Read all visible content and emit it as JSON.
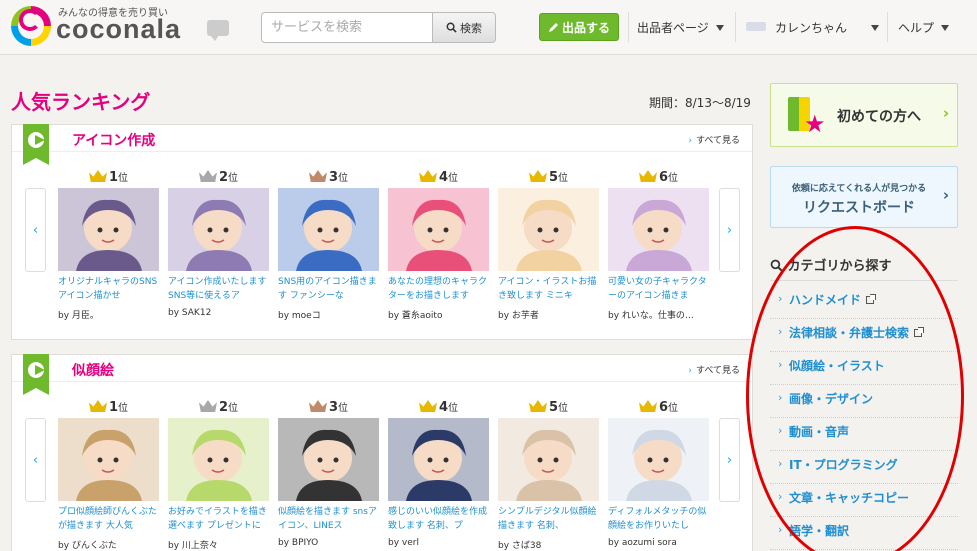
{
  "header": {
    "logo_tagline": "みんなの得意を売り買い",
    "logo_text": "coconala",
    "search_placeholder": "サービスを検索",
    "search_button": "検索",
    "sell_button": "出品する",
    "seller_page": "出品者ページ",
    "user_name": "カレンちゃん",
    "help": "ヘルプ"
  },
  "main": {
    "title": "人気ランキング",
    "period": "期間：8/13〜8/19",
    "see_all": "すべて見る",
    "rank_suffix": "位",
    "colors": {
      "accent": "#e5007f",
      "green": "#6fba2c",
      "link": "#1f8fd0",
      "gold": "#e6b800",
      "silver": "#a8a8a8",
      "bronze": "#c08a6a"
    },
    "sections": [
      {
        "category": "アイコン作成",
        "items": [
          {
            "rank": "1",
            "title": "オリジナルキャラのSNSアイコン描かせ",
            "by": "by 月臣。"
          },
          {
            "rank": "2",
            "title": "アイコン作成いたします SNS等に使えるア",
            "by": "by SAK12"
          },
          {
            "rank": "3",
            "title": "SNS用のアイコン描きます ファンシーな",
            "by": "by moeコ"
          },
          {
            "rank": "4",
            "title": "あなたの理想のキャラクターをお描きします",
            "by": "by 蒼糸aoito"
          },
          {
            "rank": "5",
            "title": "アイコン・イラストお描き致します ミニキ",
            "by": "by お芋者"
          },
          {
            "rank": "6",
            "title": "可愛い女の子キャラクターのアイコン描きま",
            "by": "by れいな。仕事の…"
          }
        ]
      },
      {
        "category": "似顔絵",
        "items": [
          {
            "rank": "1",
            "title": "プロ似顔絵師ぴんくぶたが描きます 大人気",
            "by": "by ぴんくぶた"
          },
          {
            "rank": "2",
            "title": "お好みでイラストを描き選べます プレゼントに",
            "by": "by 川上奈々"
          },
          {
            "rank": "3",
            "title": "似顔絵を描きます snsアイコン、LINEス",
            "by": "by BPIYO"
          },
          {
            "rank": "4",
            "title": "感じのいい似顔絵を作成致します 名刺、プ",
            "by": "by verl"
          },
          {
            "rank": "5",
            "title": "シンプルデジタル似顔絵描きます 名刺、",
            "by": "by さば38"
          },
          {
            "rank": "6",
            "title": "ディフォルメタッチの似顔絵をお作りいたし",
            "by": "by aozumi sora"
          }
        ]
      }
    ]
  },
  "sidebar": {
    "beginner": "初めての方へ",
    "request_sub": "依頼に応えてくれる人が見つかる",
    "request_main": "リクエストボード",
    "category_heading": "カテゴリから探す",
    "categories": [
      {
        "label": "ハンドメイド",
        "external": true
      },
      {
        "label": "法律相談・弁護士検索",
        "external": true
      },
      {
        "label": "似顔絵・イラスト",
        "external": false
      },
      {
        "label": "画像・デザイン",
        "external": false
      },
      {
        "label": "動画・音声",
        "external": false
      },
      {
        "label": "IT・プログラミング",
        "external": false
      },
      {
        "label": "文章・キャッチコピー",
        "external": false
      },
      {
        "label": "語学・翻訳",
        "external": false
      }
    ]
  }
}
